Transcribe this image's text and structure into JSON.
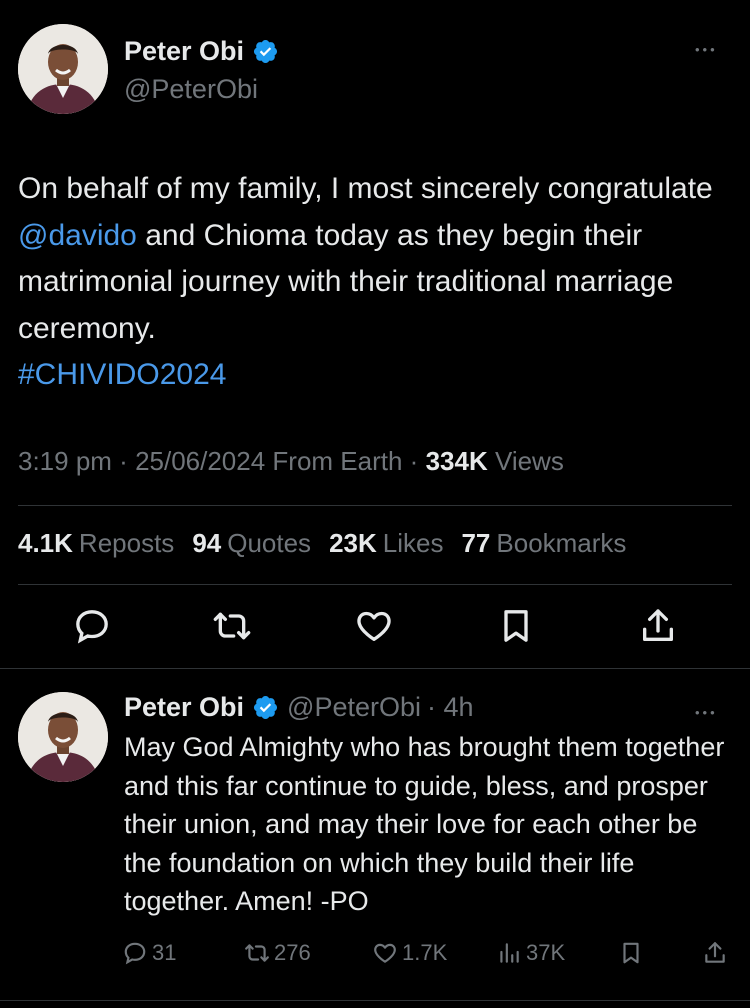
{
  "tweet": {
    "author": {
      "name": "Peter Obi",
      "handle": "@PeterObi"
    },
    "more_label": "•••",
    "text_parts": {
      "p1": "On behalf of my family, I most sincerely congratulate ",
      "mention": "@davido",
      "p2": " and Chioma today as they begin their matrimonial journey with their traditional marriage ceremony. ",
      "hashtag": "#CHIVIDO2024"
    },
    "meta": {
      "time": "3:19 pm",
      "sep": " · ",
      "date": "25/06/2024",
      "source": " From Earth",
      "views_count": "334K",
      "views_label": " Views"
    },
    "stats": [
      {
        "count": "4.1K",
        "label": "Reposts"
      },
      {
        "count": "94",
        "label": "Quotes"
      },
      {
        "count": "23K",
        "label": "Likes"
      },
      {
        "count": "77",
        "label": "Bookmarks"
      }
    ],
    "actions": [
      "reply-icon",
      "repost-icon",
      "like-icon",
      "bookmark-icon",
      "share-icon"
    ]
  },
  "reply": {
    "author": {
      "name": "Peter Obi",
      "handle": "@PeterObi",
      "time": "· 4h"
    },
    "more_label": "•••",
    "text": "May God Almighty who has brought them together and this far continue to guide, bless, and prosper their union, and may their love for each other be the foundation on which they build their life together. Amen! -PO",
    "actions": {
      "replies": "31",
      "reposts": "276",
      "likes": "1.7K",
      "views": "37K"
    }
  },
  "colors": {
    "background": "#000000",
    "text": "#e7e9ea",
    "secondary": "#71767b",
    "link": "#4a99e9",
    "verified": "#1d9bf0",
    "divider": "#2f3336"
  }
}
